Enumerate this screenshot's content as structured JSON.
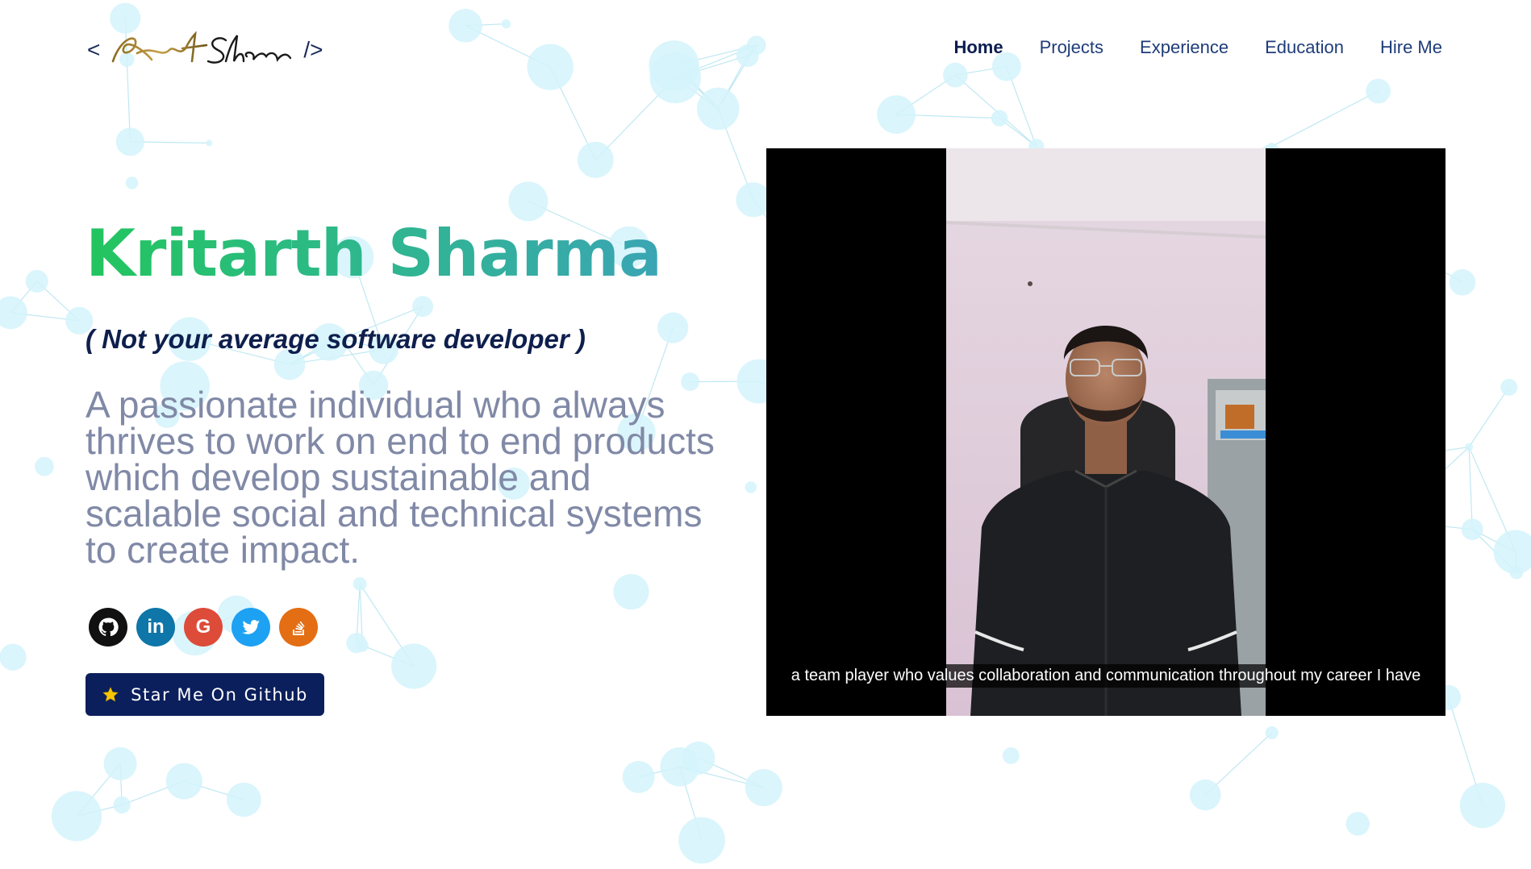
{
  "header": {
    "logo": {
      "open": "<",
      "signature": "Kritarth Sharma",
      "close": "/>"
    },
    "nav": [
      {
        "label": "Home",
        "active": true
      },
      {
        "label": "Projects",
        "active": false
      },
      {
        "label": "Experience",
        "active": false
      },
      {
        "label": "Education",
        "active": false
      },
      {
        "label": "Hire Me",
        "active": false
      }
    ]
  },
  "hero": {
    "name": "Kritarth Sharma",
    "tagline": "( Not your average software developer )",
    "description": "A passionate individual who always thrives to work on end to end products which develop sustainable and scalable social and technical systems to create impact."
  },
  "socials": [
    {
      "name": "github",
      "icon": "github-icon",
      "color": "#111111"
    },
    {
      "name": "linkedin",
      "icon": "linkedin-icon",
      "glyph": "in",
      "color": "#0e76a8"
    },
    {
      "name": "google",
      "icon": "google-icon",
      "glyph": "G",
      "color": "#dd4b39"
    },
    {
      "name": "twitter",
      "icon": "twitter-icon",
      "color": "#1da1f2"
    },
    {
      "name": "stackoverflow",
      "icon": "stackoverflow-icon",
      "color": "#e36e14"
    }
  ],
  "star_button": {
    "label": "Star Me On Github",
    "icon": "star-icon"
  },
  "video": {
    "caption": "a team player who values collaboration and communication throughout my career I have"
  },
  "colors": {
    "name_gradient_start": "#22c55e",
    "name_gradient_end": "#3aa5b4",
    "tagline": "#0e1f4d",
    "description": "#8089a6",
    "button_bg": "#0b1f5c",
    "nav_text": "#1f3c78"
  }
}
